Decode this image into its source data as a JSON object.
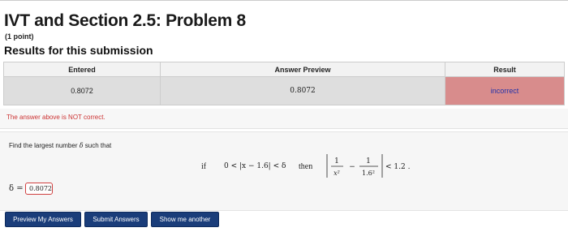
{
  "problem": {
    "title": "IVT and Section 2.5: Problem 8",
    "points": "(1 point)"
  },
  "results": {
    "heading": "Results for this submission",
    "columns": [
      "Entered",
      "Answer Preview",
      "Result"
    ],
    "row": {
      "entered": "0.8072",
      "preview": "0.8072",
      "result": "incorrect"
    },
    "message": "The answer above is NOT correct."
  },
  "question": {
    "prompt_prefix": "Find the largest number",
    "prompt_symbol": "δ",
    "prompt_suffix": "such that",
    "if_word": "if",
    "condition": "0 < |x − 1.6| < δ",
    "then_word": "then",
    "frac1_num": "1",
    "frac1_den": "x²",
    "minus": "−",
    "frac2_num": "1",
    "frac2_den": "1.6²",
    "bound": "< 1.2 .",
    "answer_label": "δ =",
    "answer_value": "0.8072"
  },
  "buttons": {
    "preview": "Preview My Answers",
    "submit": "Submit Answers",
    "show": "Show me another"
  },
  "colors": {
    "incorrect_bg": "#d88c8c",
    "button_bg": "#1a3d7a",
    "error_text": "#cc3333"
  }
}
